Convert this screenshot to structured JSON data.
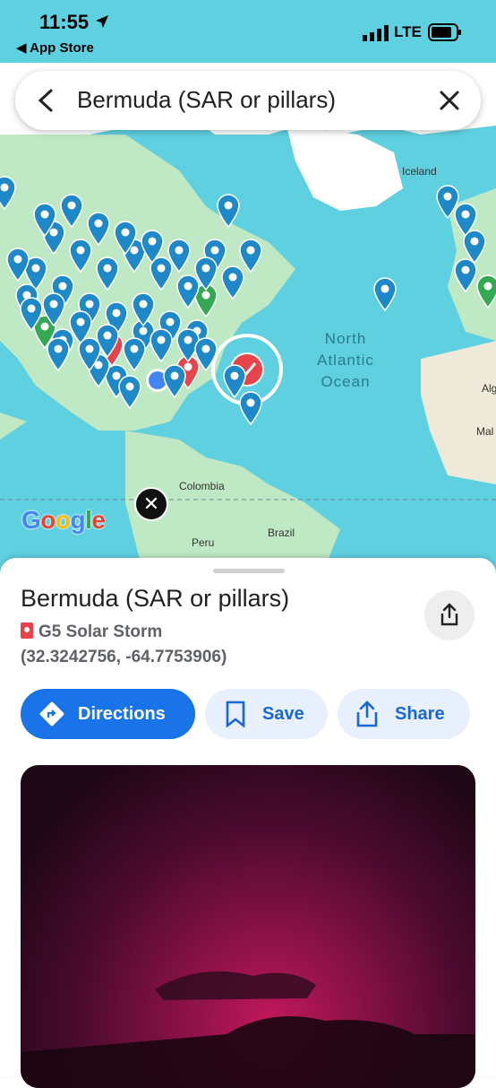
{
  "status": {
    "time": "11:55",
    "back_app": "◀ App Store",
    "network": "LTE"
  },
  "search": {
    "query": "Bermuda (SAR or pillars)"
  },
  "map": {
    "labels": {
      "iceland": "Iceland",
      "alg": "Alg",
      "mal": "Mal",
      "colombia": "Colombia",
      "peru": "Peru",
      "brazil": "Brazil"
    },
    "ocean_lines": [
      "North",
      "Atlantic",
      "Ocean"
    ],
    "attribution": "Google"
  },
  "place": {
    "title": "Bermuda (SAR or pillars)",
    "list_name": "G5 Solar Storm",
    "coordinates": "(32.3242756, -64.7753906)"
  },
  "actions": {
    "directions": "Directions",
    "save": "Save",
    "share": "Share"
  },
  "colors": {
    "accent": "#1a73e8",
    "pin_blue": "#1e88c8",
    "pin_red": "#e8424a",
    "pin_green": "#34a853",
    "water": "#5fd0e0",
    "land": "#bfe8c4"
  }
}
